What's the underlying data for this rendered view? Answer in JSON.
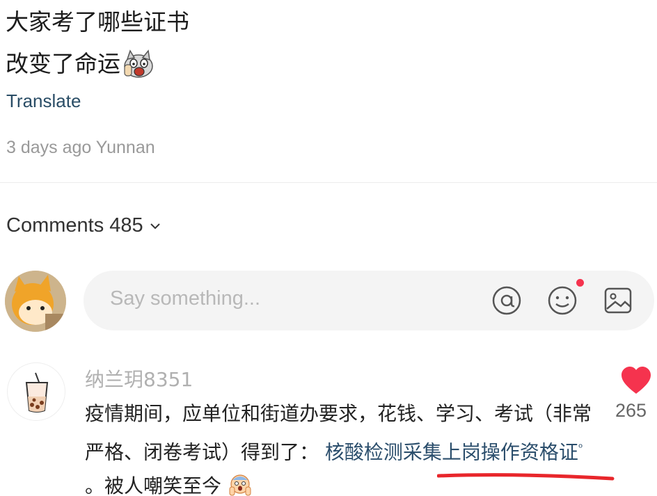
{
  "post": {
    "title_line1": "大家考了哪些证书",
    "title_line2": "改变了命运",
    "title_emoji": "cat-screaming-emoji",
    "translate_label": "Translate",
    "meta": "3 days ago Yunnan"
  },
  "comments": {
    "label": "Comments",
    "count": "485",
    "input_placeholder": "Say something...",
    "icons": [
      "at-icon",
      "smile-icon",
      "image-icon"
    ],
    "notification_dot_color": "#f5334e"
  },
  "comment": {
    "username": "纳兰玥8351",
    "text_plain": "疫情期间，应单位和街道办要求，花钱、学习、考试（非常严格、闭卷考试）得到了：",
    "text_link": "核酸检测采集上岗操作资格证",
    "text_after": "。被人嘲笑至今",
    "end_emoji": "scared-face-emoji",
    "likes": "265",
    "like_color": "#f5334e"
  }
}
